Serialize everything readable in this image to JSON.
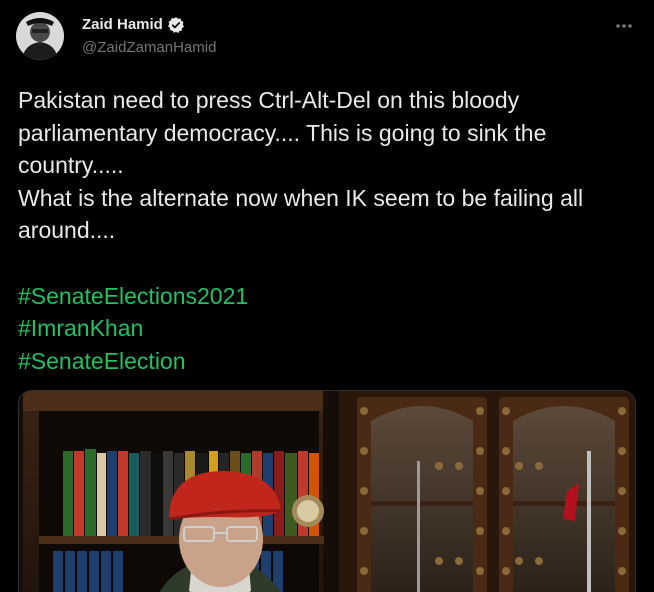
{
  "author": {
    "display_name": "Zaid Hamid",
    "handle": "@ZaidZamanHamid",
    "verified": true,
    "avatar_icon": "profile-photo"
  },
  "menu": {
    "icon": "more-horizontal-icon"
  },
  "tweet": {
    "lines": [
      "Pakistan need to press Ctrl-Alt-Del on this bloody",
      "parliamentary democracy.... This is going to sink the",
      "country.....",
      "What is the alternate now when IK seem to be failing all",
      "around...."
    ],
    "hashtags": [
      "#SenateElections2021",
      "#ImranKhan",
      "#SenateElection"
    ]
  },
  "media": {
    "type": "video-thumbnail",
    "description_icon": "video-frame"
  },
  "colors": {
    "background": "#000000",
    "text": "#e7e9ea",
    "secondary": "#71767b",
    "hashtag": "#23c063",
    "verified": "#1d9bf0"
  }
}
